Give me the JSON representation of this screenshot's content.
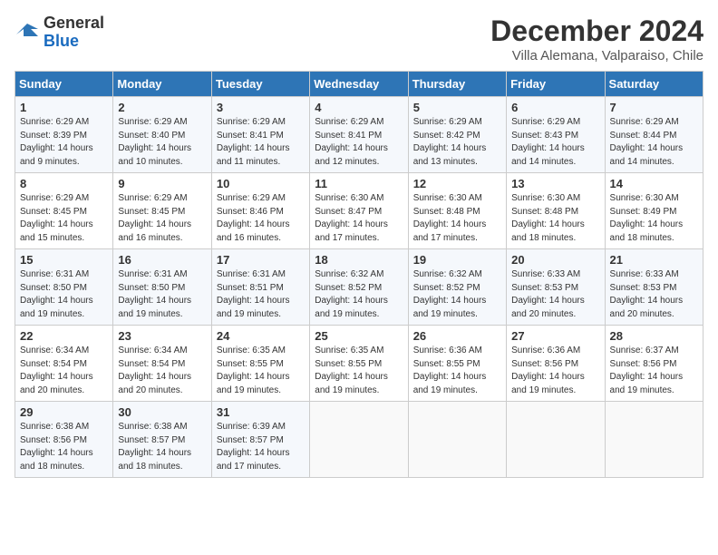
{
  "header": {
    "logo_general": "General",
    "logo_blue": "Blue",
    "month_title": "December 2024",
    "location": "Villa Alemana, Valparaiso, Chile"
  },
  "weekdays": [
    "Sunday",
    "Monday",
    "Tuesday",
    "Wednesday",
    "Thursday",
    "Friday",
    "Saturday"
  ],
  "weeks": [
    [
      {
        "day": "1",
        "sunrise": "Sunrise: 6:29 AM",
        "sunset": "Sunset: 8:39 PM",
        "daylight": "Daylight: 14 hours and 9 minutes."
      },
      {
        "day": "2",
        "sunrise": "Sunrise: 6:29 AM",
        "sunset": "Sunset: 8:40 PM",
        "daylight": "Daylight: 14 hours and 10 minutes."
      },
      {
        "day": "3",
        "sunrise": "Sunrise: 6:29 AM",
        "sunset": "Sunset: 8:41 PM",
        "daylight": "Daylight: 14 hours and 11 minutes."
      },
      {
        "day": "4",
        "sunrise": "Sunrise: 6:29 AM",
        "sunset": "Sunset: 8:41 PM",
        "daylight": "Daylight: 14 hours and 12 minutes."
      },
      {
        "day": "5",
        "sunrise": "Sunrise: 6:29 AM",
        "sunset": "Sunset: 8:42 PM",
        "daylight": "Daylight: 14 hours and 13 minutes."
      },
      {
        "day": "6",
        "sunrise": "Sunrise: 6:29 AM",
        "sunset": "Sunset: 8:43 PM",
        "daylight": "Daylight: 14 hours and 14 minutes."
      },
      {
        "day": "7",
        "sunrise": "Sunrise: 6:29 AM",
        "sunset": "Sunset: 8:44 PM",
        "daylight": "Daylight: 14 hours and 14 minutes."
      }
    ],
    [
      {
        "day": "8",
        "sunrise": "Sunrise: 6:29 AM",
        "sunset": "Sunset: 8:45 PM",
        "daylight": "Daylight: 14 hours and 15 minutes."
      },
      {
        "day": "9",
        "sunrise": "Sunrise: 6:29 AM",
        "sunset": "Sunset: 8:45 PM",
        "daylight": "Daylight: 14 hours and 16 minutes."
      },
      {
        "day": "10",
        "sunrise": "Sunrise: 6:29 AM",
        "sunset": "Sunset: 8:46 PM",
        "daylight": "Daylight: 14 hours and 16 minutes."
      },
      {
        "day": "11",
        "sunrise": "Sunrise: 6:30 AM",
        "sunset": "Sunset: 8:47 PM",
        "daylight": "Daylight: 14 hours and 17 minutes."
      },
      {
        "day": "12",
        "sunrise": "Sunrise: 6:30 AM",
        "sunset": "Sunset: 8:48 PM",
        "daylight": "Daylight: 14 hours and 17 minutes."
      },
      {
        "day": "13",
        "sunrise": "Sunrise: 6:30 AM",
        "sunset": "Sunset: 8:48 PM",
        "daylight": "Daylight: 14 hours and 18 minutes."
      },
      {
        "day": "14",
        "sunrise": "Sunrise: 6:30 AM",
        "sunset": "Sunset: 8:49 PM",
        "daylight": "Daylight: 14 hours and 18 minutes."
      }
    ],
    [
      {
        "day": "15",
        "sunrise": "Sunrise: 6:31 AM",
        "sunset": "Sunset: 8:50 PM",
        "daylight": "Daylight: 14 hours and 19 minutes."
      },
      {
        "day": "16",
        "sunrise": "Sunrise: 6:31 AM",
        "sunset": "Sunset: 8:50 PM",
        "daylight": "Daylight: 14 hours and 19 minutes."
      },
      {
        "day": "17",
        "sunrise": "Sunrise: 6:31 AM",
        "sunset": "Sunset: 8:51 PM",
        "daylight": "Daylight: 14 hours and 19 minutes."
      },
      {
        "day": "18",
        "sunrise": "Sunrise: 6:32 AM",
        "sunset": "Sunset: 8:52 PM",
        "daylight": "Daylight: 14 hours and 19 minutes."
      },
      {
        "day": "19",
        "sunrise": "Sunrise: 6:32 AM",
        "sunset": "Sunset: 8:52 PM",
        "daylight": "Daylight: 14 hours and 19 minutes."
      },
      {
        "day": "20",
        "sunrise": "Sunrise: 6:33 AM",
        "sunset": "Sunset: 8:53 PM",
        "daylight": "Daylight: 14 hours and 20 minutes."
      },
      {
        "day": "21",
        "sunrise": "Sunrise: 6:33 AM",
        "sunset": "Sunset: 8:53 PM",
        "daylight": "Daylight: 14 hours and 20 minutes."
      }
    ],
    [
      {
        "day": "22",
        "sunrise": "Sunrise: 6:34 AM",
        "sunset": "Sunset: 8:54 PM",
        "daylight": "Daylight: 14 hours and 20 minutes."
      },
      {
        "day": "23",
        "sunrise": "Sunrise: 6:34 AM",
        "sunset": "Sunset: 8:54 PM",
        "daylight": "Daylight: 14 hours and 20 minutes."
      },
      {
        "day": "24",
        "sunrise": "Sunrise: 6:35 AM",
        "sunset": "Sunset: 8:55 PM",
        "daylight": "Daylight: 14 hours and 19 minutes."
      },
      {
        "day": "25",
        "sunrise": "Sunrise: 6:35 AM",
        "sunset": "Sunset: 8:55 PM",
        "daylight": "Daylight: 14 hours and 19 minutes."
      },
      {
        "day": "26",
        "sunrise": "Sunrise: 6:36 AM",
        "sunset": "Sunset: 8:55 PM",
        "daylight": "Daylight: 14 hours and 19 minutes."
      },
      {
        "day": "27",
        "sunrise": "Sunrise: 6:36 AM",
        "sunset": "Sunset: 8:56 PM",
        "daylight": "Daylight: 14 hours and 19 minutes."
      },
      {
        "day": "28",
        "sunrise": "Sunrise: 6:37 AM",
        "sunset": "Sunset: 8:56 PM",
        "daylight": "Daylight: 14 hours and 19 minutes."
      }
    ],
    [
      {
        "day": "29",
        "sunrise": "Sunrise: 6:38 AM",
        "sunset": "Sunset: 8:56 PM",
        "daylight": "Daylight: 14 hours and 18 minutes."
      },
      {
        "day": "30",
        "sunrise": "Sunrise: 6:38 AM",
        "sunset": "Sunset: 8:57 PM",
        "daylight": "Daylight: 14 hours and 18 minutes."
      },
      {
        "day": "31",
        "sunrise": "Sunrise: 6:39 AM",
        "sunset": "Sunset: 8:57 PM",
        "daylight": "Daylight: 14 hours and 17 minutes."
      },
      null,
      null,
      null,
      null
    ]
  ]
}
